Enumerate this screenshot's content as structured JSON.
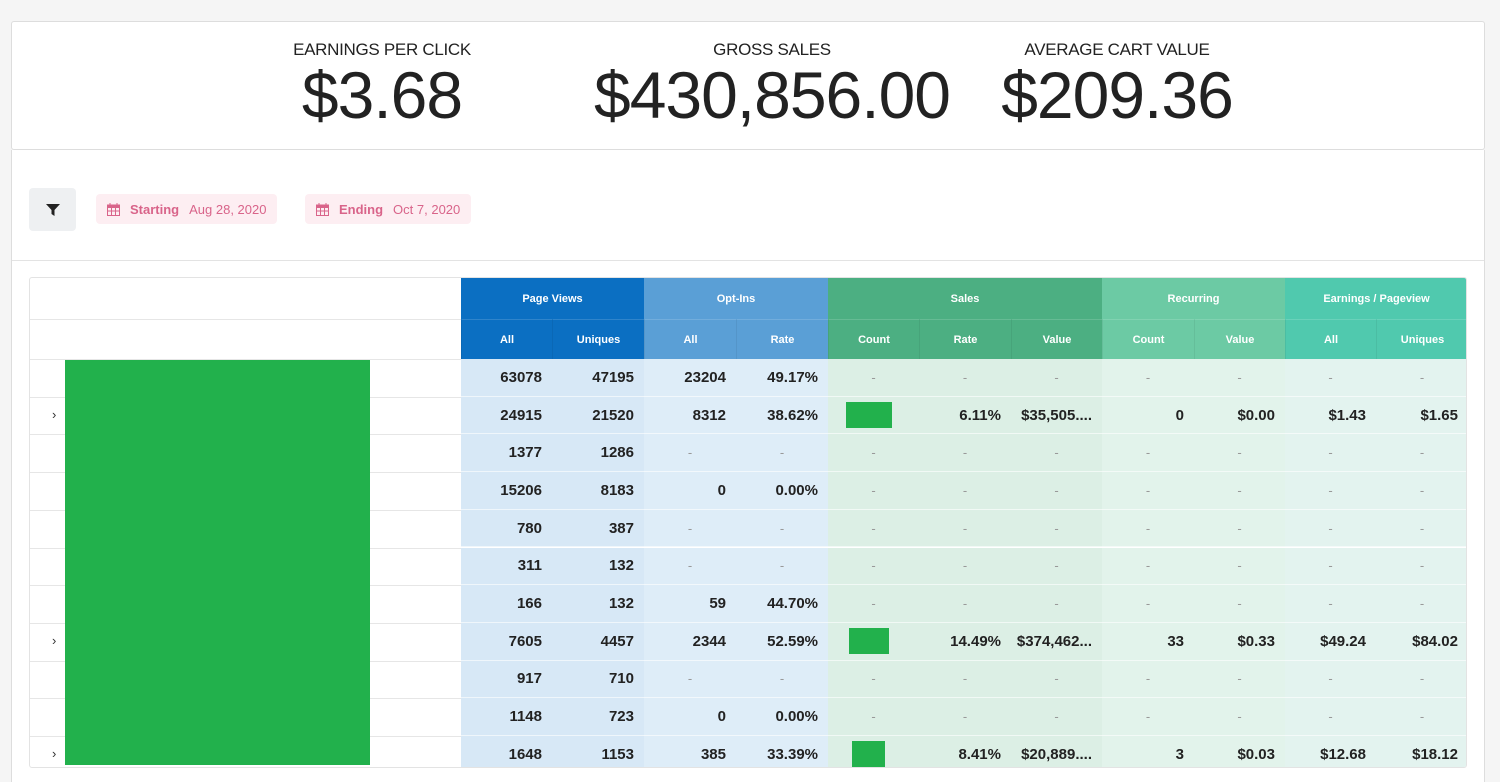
{
  "stats": [
    {
      "label": "EARNINGS PER CLICK",
      "value": "$3.68"
    },
    {
      "label": "GROSS SALES",
      "value": "$430,856.00"
    },
    {
      "label": "AVERAGE CART VALUE",
      "value": "$209.36"
    }
  ],
  "filters": {
    "starting_label": "Starting",
    "starting_value": "Aug 28, 2020",
    "ending_label": "Ending",
    "ending_value": "Oct 7, 2020"
  },
  "groups": [
    {
      "label": "Page Views",
      "color": "#0b6fc2"
    },
    {
      "label": "Opt-Ins",
      "color": "#5a9fd6"
    },
    {
      "label": "Sales",
      "color": "#4caf82"
    },
    {
      "label": "Recurring",
      "color": "#6ccaa4"
    },
    {
      "label": "Earnings / Pageview",
      "color": "#50c9ae"
    }
  ],
  "subcols": [
    "All",
    "Uniques",
    "All",
    "Rate",
    "Count",
    "Rate",
    "Value",
    "Count",
    "Value",
    "All",
    "Uniques"
  ],
  "rows": [
    {
      "expand": false,
      "cells": [
        "63078",
        "47195",
        "23204",
        "49.17%",
        "-",
        "-",
        "-",
        "-",
        "-",
        "-",
        "-"
      ]
    },
    {
      "expand": true,
      "cells": [
        "24915",
        "21520",
        "8312",
        "38.62%",
        "",
        "6.11%",
        "$35,505....",
        "0",
        "$0.00",
        "$1.43",
        "$1.65"
      ]
    },
    {
      "expand": false,
      "cells": [
        "1377",
        "1286",
        "-",
        "-",
        "-",
        "-",
        "-",
        "-",
        "-",
        "-",
        "-"
      ]
    },
    {
      "expand": false,
      "cells": [
        "15206",
        "8183",
        "0",
        "0.00%",
        "-",
        "-",
        "-",
        "-",
        "-",
        "-",
        "-"
      ]
    },
    {
      "expand": false,
      "cells": [
        "780",
        "387",
        "-",
        "-",
        "-",
        "-",
        "-",
        "-",
        "-",
        "-",
        "-"
      ]
    },
    {
      "expand": false,
      "cells": [
        "311",
        "132",
        "-",
        "-",
        "-",
        "-",
        "-",
        "-",
        "-",
        "-",
        "-"
      ]
    },
    {
      "expand": false,
      "cells": [
        "166",
        "132",
        "59",
        "44.70%",
        "-",
        "-",
        "-",
        "-",
        "-",
        "-",
        "-"
      ]
    },
    {
      "expand": true,
      "cells": [
        "7605",
        "4457",
        "2344",
        "52.59%",
        "",
        "14.49%",
        "$374,462...",
        "33",
        "$0.33",
        "$49.24",
        "$84.02"
      ]
    },
    {
      "expand": false,
      "cells": [
        "917",
        "710",
        "-",
        "-",
        "-",
        "-",
        "-",
        "-",
        "-",
        "-",
        "-"
      ]
    },
    {
      "expand": false,
      "cells": [
        "1148",
        "723",
        "0",
        "0.00%",
        "-",
        "-",
        "-",
        "-",
        "-",
        "-",
        "-"
      ]
    },
    {
      "expand": true,
      "cells": [
        "1648",
        "1153",
        "385",
        "33.39%",
        "",
        "8.41%",
        "$20,889....",
        "3",
        "$0.03",
        "$12.68",
        "$18.12"
      ]
    }
  ]
}
